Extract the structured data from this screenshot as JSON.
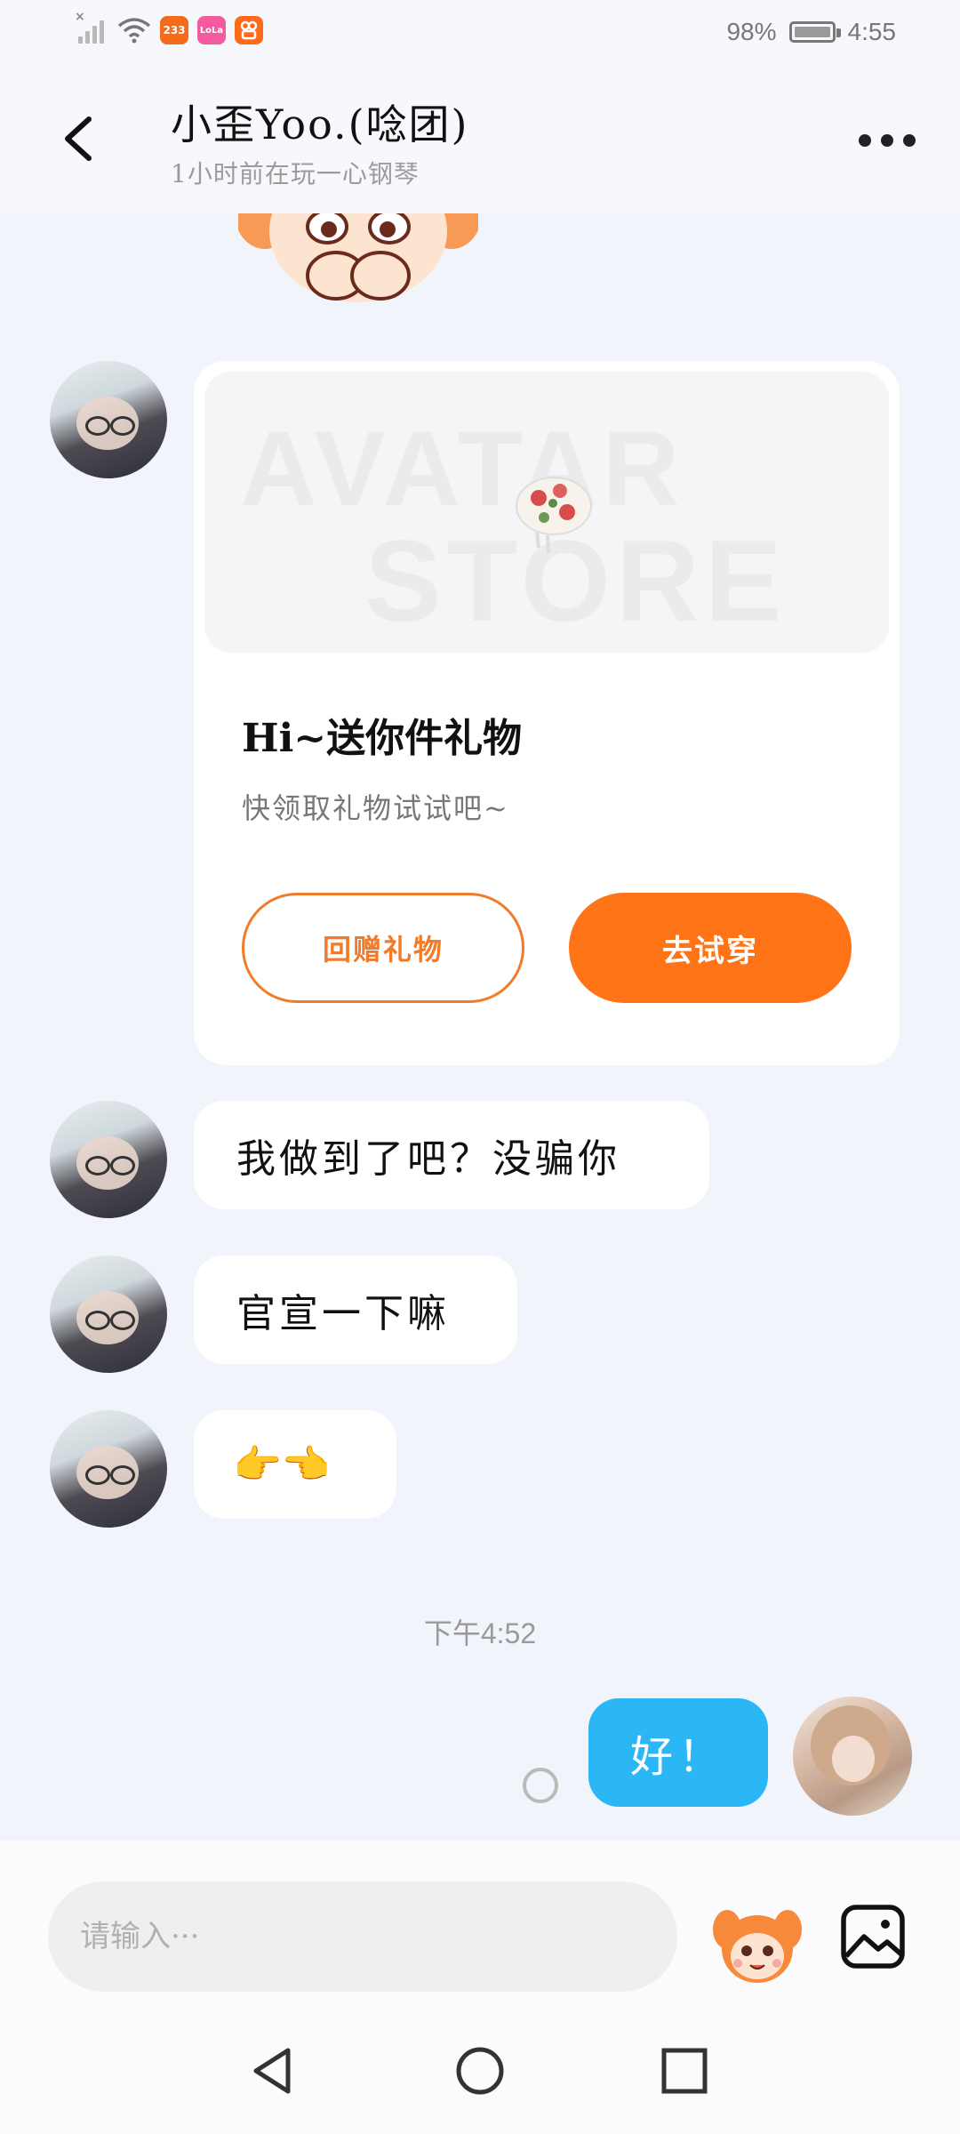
{
  "status_bar": {
    "app_badges": [
      "233",
      "LoLa",
      ""
    ],
    "battery": "98%",
    "time": "4:55"
  },
  "header": {
    "title": "小歪Yoo.(唸团)",
    "subtitle": "1小时前在玩一心钢琴"
  },
  "gift_card": {
    "banner_words": [
      "AVATAR",
      "STORE"
    ],
    "title": "Hi~送你件礼物",
    "subtitle": "快领取礼物试试吧~",
    "return_gift_label": "回赠礼物",
    "try_on_label": "去试穿"
  },
  "messages": [
    {
      "text": "我做到了吧？没骗你"
    },
    {
      "text": "官宣一下嘛"
    },
    {
      "text": "👉👈"
    }
  ],
  "timestamp": "下午4:52",
  "my_message": {
    "text": "好！"
  },
  "input": {
    "placeholder": "请输入···"
  },
  "colors": {
    "accent_orange": "#ff7417",
    "my_bubble_blue": "#2bb7f6",
    "background": "#f2f4fb"
  },
  "icons": [
    "back-arrow-icon",
    "more-dots-icon",
    "mascot-icon",
    "image-picker-icon",
    "nav-back-icon",
    "nav-home-icon",
    "nav-recents-icon"
  ]
}
